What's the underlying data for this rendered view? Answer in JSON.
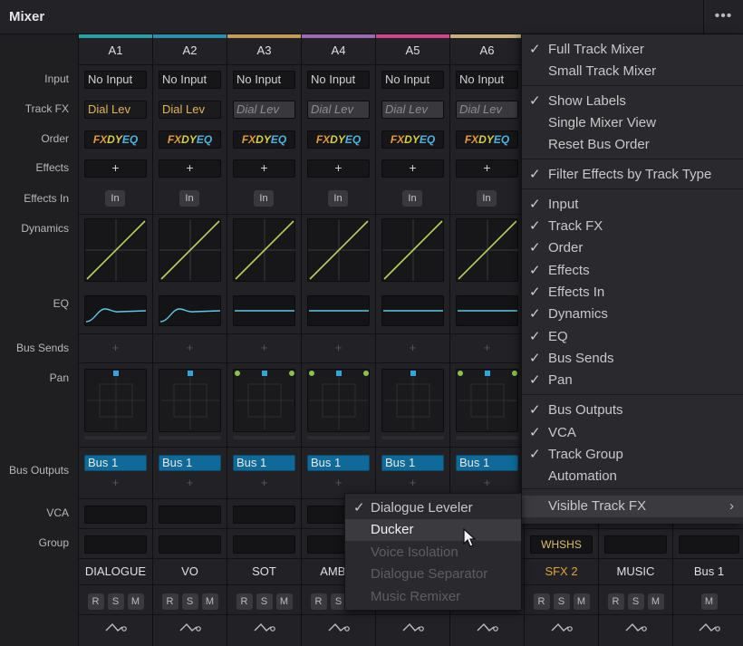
{
  "panel": {
    "title": "Mixer",
    "more_icon": "•••"
  },
  "row_labels": {
    "input": "Input",
    "track_fx": "Track FX",
    "order": "Order",
    "effects": "Effects",
    "effects_in": "Effects In",
    "dynamics": "Dynamics",
    "eq": "EQ",
    "bus_sends": "Bus Sends",
    "pan": "Pan",
    "bus_outputs": "Bus Outputs",
    "vca": "VCA",
    "group": "Group"
  },
  "order_parts": {
    "fx": "FX",
    "dy": "DY",
    "eq": "EQ"
  },
  "plus": "+",
  "in_label": "In",
  "rsm": {
    "r": "R",
    "s": "S",
    "m": "M"
  },
  "strips": [
    {
      "channel": "A1",
      "color": "#2aa0a8",
      "input": "No Input",
      "track_fx": "Dial Lev",
      "fx_active": true,
      "bus_output": "Bus 1",
      "track_name": "DIALOGUE",
      "pan_stereo": false,
      "eq_curve": true
    },
    {
      "channel": "A2",
      "color": "#2a8fb0",
      "input": "No Input",
      "track_fx": "Dial Lev",
      "fx_active": true,
      "bus_output": "Bus 1",
      "track_name": "VO",
      "pan_stereo": false,
      "eq_curve": true
    },
    {
      "channel": "A3",
      "color": "#c89a5a",
      "input": "No Input",
      "track_fx": "Dial Lev",
      "fx_active": false,
      "bus_output": "Bus 1",
      "track_name": "SOT",
      "pan_stereo": true,
      "eq_curve": false
    },
    {
      "channel": "A4",
      "color": "#9a6ab8",
      "input": "No Input",
      "track_fx": "Dial Lev",
      "fx_active": false,
      "bus_output": "Bus 1",
      "track_name": "AMBIE",
      "pan_stereo": true,
      "eq_curve": false
    },
    {
      "channel": "A5",
      "color": "#d0468a",
      "input": "No Input",
      "track_fx": "Dial Lev",
      "fx_active": false,
      "bus_output": "Bus 1",
      "track_name": "",
      "pan_stereo": false,
      "eq_curve": false
    },
    {
      "channel": "A6",
      "color": "#c8b07a",
      "input": "No Input",
      "track_fx": "Dial Lev",
      "fx_active": false,
      "bus_output": "Bus 1",
      "track_name": "",
      "pan_stereo": true,
      "eq_curve": false
    }
  ],
  "hidden_strips": [
    {
      "group": "WHSHS",
      "track_name": "SFX 2",
      "name_color": "#e3a13a"
    },
    {
      "group": "",
      "track_name": "MUSIC",
      "name_color": "#e0e0e0"
    },
    {
      "group": "",
      "track_name": "Bus 1",
      "name_color": "#e0e0e0"
    }
  ],
  "menu": {
    "items": [
      {
        "label": "Full Track Mixer",
        "checked": true
      },
      {
        "label": "Small Track Mixer",
        "checked": false
      },
      {
        "label": "Show Labels",
        "checked": true
      },
      {
        "label": "Single Mixer View",
        "checked": false
      },
      {
        "label": "Reset Bus Order",
        "checked": false
      },
      {
        "label": "Filter Effects by Track Type",
        "checked": true
      },
      {
        "label": "Input",
        "checked": true
      },
      {
        "label": "Track FX",
        "checked": true
      },
      {
        "label": "Order",
        "checked": true
      },
      {
        "label": "Effects",
        "checked": true
      },
      {
        "label": "Effects In",
        "checked": true
      },
      {
        "label": "Dynamics",
        "checked": true
      },
      {
        "label": "EQ",
        "checked": true
      },
      {
        "label": "Bus Sends",
        "checked": true
      },
      {
        "label": "Pan",
        "checked": true
      },
      {
        "label": "Bus Outputs",
        "checked": true
      },
      {
        "label": "VCA",
        "checked": true
      },
      {
        "label": "Track Group",
        "checked": true
      },
      {
        "label": "Automation",
        "checked": false
      },
      {
        "label": "Visible Track FX",
        "checked": false,
        "submenu": true
      }
    ],
    "check_glyph": "✓",
    "arrow_glyph": "›"
  },
  "submenu": {
    "items": [
      {
        "label": "Dialogue Leveler",
        "checked": true,
        "enabled": true
      },
      {
        "label": "Ducker",
        "checked": false,
        "enabled": true
      },
      {
        "label": "Voice Isolation",
        "checked": false,
        "enabled": false
      },
      {
        "label": "Dialogue Separator",
        "checked": false,
        "enabled": false
      },
      {
        "label": "Music Remixer",
        "checked": false,
        "enabled": false
      }
    ]
  }
}
